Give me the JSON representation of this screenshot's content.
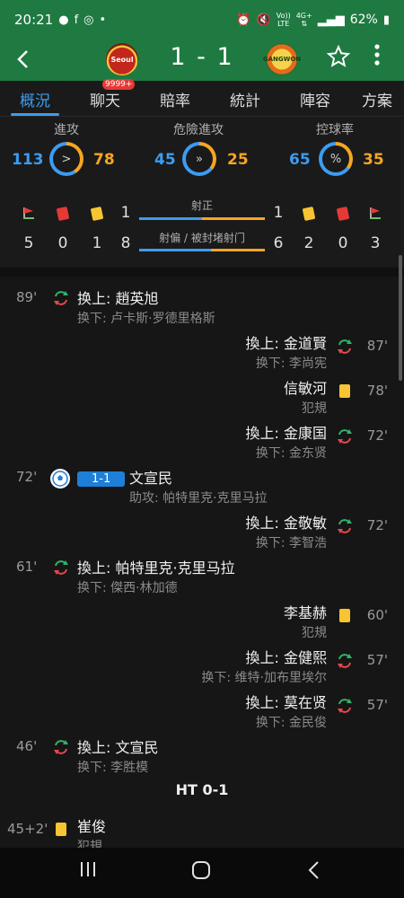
{
  "status": {
    "time": "20:21",
    "battery": "62%",
    "net_vo": "Vo))",
    "net_lte": "LTE",
    "net_4g": "4G+"
  },
  "header": {
    "home_logo_text": "Seoul",
    "away_logo_text": "GANGWON",
    "score": "1 - 1"
  },
  "tabs": [
    {
      "label": "概況"
    },
    {
      "label": "聊天",
      "badge": "9999+"
    },
    {
      "label": "賠率"
    },
    {
      "label": "統計"
    },
    {
      "label": "陣容"
    },
    {
      "label": "方案"
    }
  ],
  "stats": [
    {
      "title": "進攻",
      "home": 113,
      "away": 78,
      "symbol": ">"
    },
    {
      "title": "危險進攻",
      "home": 45,
      "away": 25,
      "symbol": "»"
    },
    {
      "title": "控球率",
      "home": 65,
      "away": 35,
      "symbol": "%"
    }
  ],
  "cards": {
    "home_corners": "5",
    "home_red": "0",
    "home_yellow": "1",
    "away_yellow": "2",
    "away_red": "0",
    "away_corners": "3"
  },
  "shots": {
    "on_label": "射正",
    "on_home": "1",
    "on_away": "1",
    "off_label": "射偏 / 被封堵射门",
    "off_home": "8",
    "off_away": "6"
  },
  "events": [
    {
      "side": "home",
      "type": "sub",
      "minute": "89'",
      "line1": "换上: 趙英旭",
      "line2": "换下: 卢卡斯·罗德里格斯"
    },
    {
      "side": "away",
      "type": "sub",
      "minute": "87'",
      "line1": "換上: 金道賢",
      "line2": "换下: 李尚宪"
    },
    {
      "side": "away",
      "type": "yellow",
      "minute": "78'",
      "line1": "信敏河",
      "line2": "犯規"
    },
    {
      "side": "away",
      "type": "sub",
      "minute": "72'",
      "line1": "換上: 金康国",
      "line2": "换下: 金东贤"
    },
    {
      "side": "home",
      "type": "goal",
      "minute": "72'",
      "score": "1-1",
      "line1": "文宣民",
      "line2": "助攻: 帕特里克·克里马拉"
    },
    {
      "side": "away",
      "type": "sub",
      "minute": "72'",
      "line1": "換上: 金敬敏",
      "line2": "换下: 李智浩"
    },
    {
      "side": "home",
      "type": "sub",
      "minute": "61'",
      "line1": "換上: 帕特里克·克里马拉",
      "line2": "换下: 傑西·林加德"
    },
    {
      "side": "away",
      "type": "yellow",
      "minute": "60'",
      "line1": "李基赫",
      "line2": "犯規"
    },
    {
      "side": "away",
      "type": "sub",
      "minute": "57'",
      "line1": "換上: 金健熙",
      "line2": "换下: 维特·加布里埃尔"
    },
    {
      "side": "away",
      "type": "sub",
      "minute": "57'",
      "line1": "換上: 莫在贤",
      "line2": "换下: 金民俊"
    },
    {
      "side": "home",
      "type": "sub",
      "minute": "46'",
      "line1": "換上: 文宣民",
      "line2": "换下: 李胜模"
    },
    {
      "side": "center",
      "type": "ht",
      "label": "HT 0-1"
    },
    {
      "side": "home",
      "type": "yellow",
      "minute": "45+2'",
      "line1": "崔俊",
      "line2": "犯規"
    }
  ],
  "colors": {
    "header_green": "#1f7a42",
    "home_blue": "#3c9cf0",
    "away_orange": "#f6a623",
    "sub_in_green": "#2fb36b",
    "sub_out_red": "#e5484d"
  }
}
